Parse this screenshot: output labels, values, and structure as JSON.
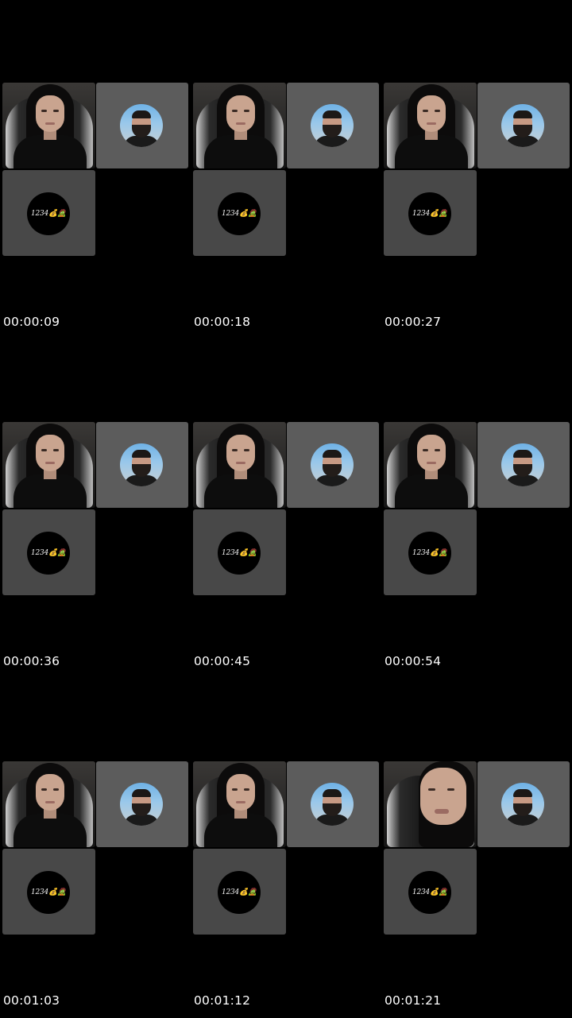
{
  "frames": [
    {
      "timestamp": "00:00:09",
      "avatar_c_text": "1234💰🧟"
    },
    {
      "timestamp": "00:00:18",
      "avatar_c_text": "1234💰🧟"
    },
    {
      "timestamp": "00:00:27",
      "avatar_c_text": "1234💰🧟"
    },
    {
      "timestamp": "00:00:36",
      "avatar_c_text": "1234💰🧟"
    },
    {
      "timestamp": "00:00:45",
      "avatar_c_text": "1234💰🧟"
    },
    {
      "timestamp": "00:00:54",
      "avatar_c_text": "1234💰🧟"
    },
    {
      "timestamp": "00:01:03",
      "avatar_c_text": "1234💰🧟"
    },
    {
      "timestamp": "00:01:12",
      "avatar_c_text": "1234💰🧟"
    },
    {
      "timestamp": "00:01:21",
      "avatar_c_text": "1234💰🧟"
    }
  ],
  "colors": {
    "background": "#000000",
    "tile_a": "#1e1e1e",
    "tile_b": "#5c5c5c",
    "tile_c": "#484848",
    "timestamp_text": "#ffffff"
  }
}
